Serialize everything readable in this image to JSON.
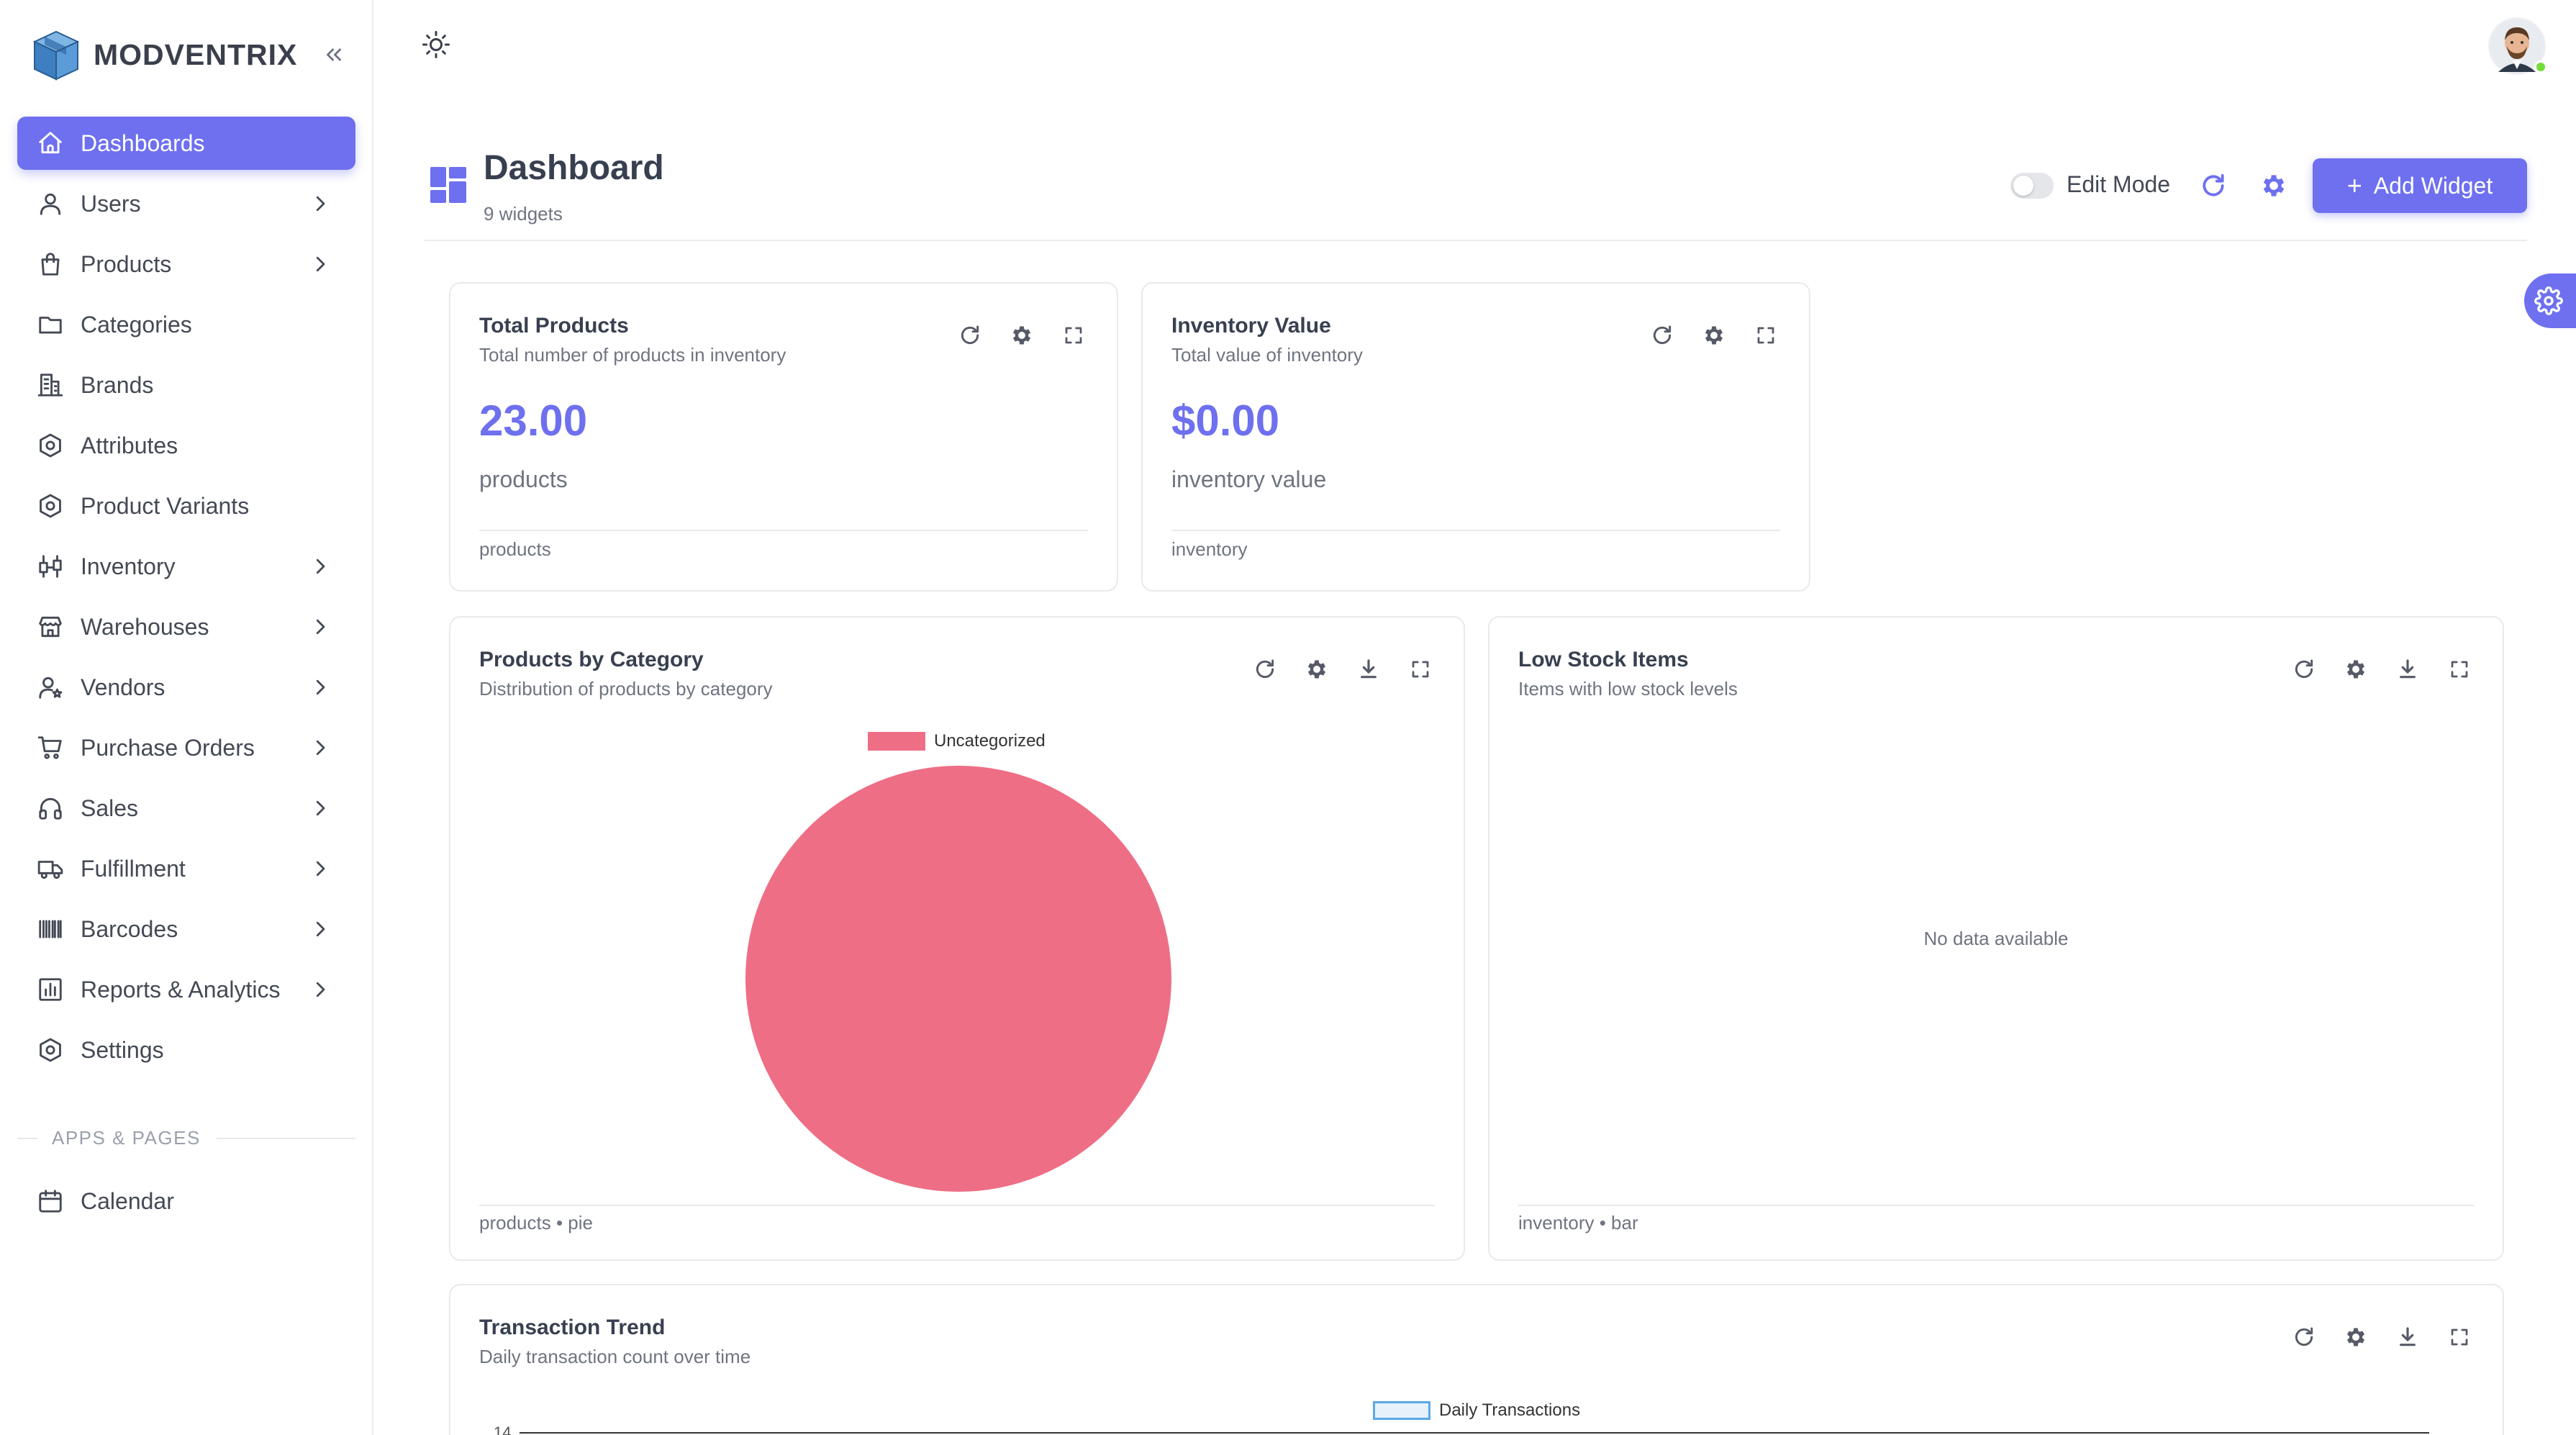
{
  "brand": {
    "name": "MODVENTRIX"
  },
  "sidebar": {
    "items": [
      {
        "label": "Dashboards",
        "icon": "home-icon",
        "active": true,
        "chevron": false
      },
      {
        "label": "Users",
        "icon": "user-icon",
        "chevron": true
      },
      {
        "label": "Products",
        "icon": "shopping-bag-icon",
        "chevron": true
      },
      {
        "label": "Categories",
        "icon": "folder-icon",
        "chevron": false
      },
      {
        "label": "Brands",
        "icon": "building-icon",
        "chevron": false
      },
      {
        "label": "Attributes",
        "icon": "hexagon-icon",
        "chevron": false
      },
      {
        "label": "Product Variants",
        "icon": "hexagon-icon",
        "chevron": false
      },
      {
        "label": "Inventory",
        "icon": "transfer-icon",
        "chevron": true
      },
      {
        "label": "Warehouses",
        "icon": "store-icon",
        "chevron": true
      },
      {
        "label": "Vendors",
        "icon": "user-star-icon",
        "chevron": true
      },
      {
        "label": "Purchase Orders",
        "icon": "cart-icon",
        "chevron": true
      },
      {
        "label": "Sales",
        "icon": "headphones-icon",
        "chevron": true
      },
      {
        "label": "Fulfillment",
        "icon": "truck-icon",
        "chevron": true
      },
      {
        "label": "Barcodes",
        "icon": "barcode-icon",
        "chevron": true
      },
      {
        "label": "Reports & Analytics",
        "icon": "chart-icon",
        "chevron": true
      },
      {
        "label": "Settings",
        "icon": "hexagon-icon",
        "chevron": false
      }
    ],
    "section_label": "APPS & PAGES",
    "apps": [
      {
        "label": "Calendar",
        "icon": "calendar-icon"
      }
    ]
  },
  "header": {
    "title": "Dashboard",
    "subtitle": "9 widgets",
    "edit_mode_label": "Edit Mode",
    "add_widget_label": "Add Widget"
  },
  "widgets": {
    "total_products": {
      "title": "Total Products",
      "subtitle": "Total number of products in inventory",
      "value": "23.00",
      "unit": "products",
      "footer": "products"
    },
    "inventory_value": {
      "title": "Inventory Value",
      "subtitle": "Total value of inventory",
      "value": "$0.00",
      "unit": "inventory value",
      "footer": "inventory"
    },
    "products_by_category": {
      "title": "Products by Category",
      "subtitle": "Distribution of products by category",
      "footer": "products • pie"
    },
    "low_stock": {
      "title": "Low Stock Items",
      "subtitle": "Items with low stock levels",
      "empty_text": "No data available",
      "footer": "inventory • bar"
    },
    "transaction_trend": {
      "title": "Transaction Trend",
      "subtitle": "Daily transaction count over time",
      "y_tick_top": "14"
    }
  },
  "colors": {
    "accent": "#6e70ef",
    "pie": "#ee6e85",
    "line": "#5aa9e6"
  },
  "chart_data": [
    {
      "type": "pie",
      "categories": [
        "Uncategorized"
      ],
      "values": [
        100
      ],
      "legend": "top"
    },
    {
      "type": "line",
      "series": [
        {
          "name": "Daily Transactions",
          "values": []
        }
      ],
      "legend": "top"
    }
  ]
}
